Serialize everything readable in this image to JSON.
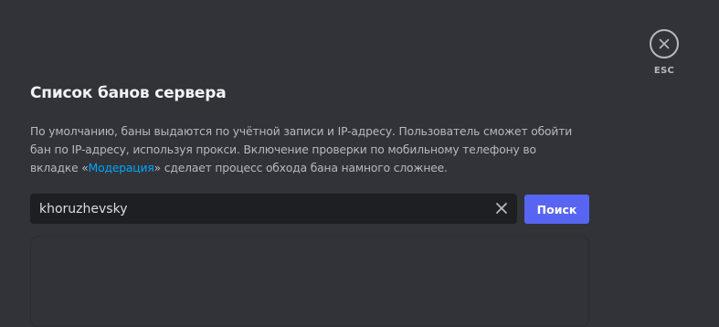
{
  "header": {
    "title": "Список банов сервера"
  },
  "description": {
    "text_before": "По умолчанию, баны выдаются по учётной записи и IP-адресу. Пользователь сможет обойти бан по IP-адресу, используя прокси. Включение проверки по мобильному телефону во вкладке «",
    "link_text": "Модерация",
    "text_after": "» сделает процесс обхода бана намного сложнее."
  },
  "search": {
    "value": "khoruzhevsky",
    "placeholder": "",
    "button_label": "Поиск",
    "clear_icon": "close-icon"
  },
  "close": {
    "icon": "close-icon",
    "label": "ESC"
  },
  "colors": {
    "background": "#313338",
    "input_background": "#1e1f22",
    "accent": "#5865f2",
    "link": "#00a8fc",
    "heading": "#f2f3f5",
    "muted_text": "#b5bac1"
  }
}
